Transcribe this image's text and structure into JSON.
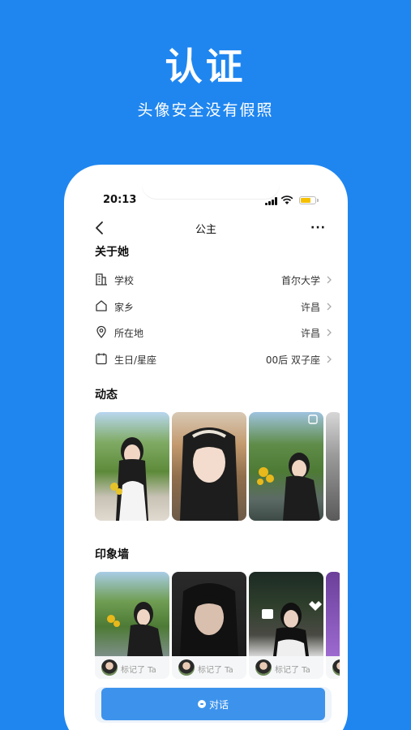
{
  "hero": {
    "title": "认证",
    "subtitle": "头像安全没有假照"
  },
  "status_bar": {
    "time": "20:13",
    "battery_level": 0.7
  },
  "nav": {
    "title": "公主"
  },
  "about": {
    "heading": "关于她",
    "rows": [
      {
        "icon": "building-icon",
        "label": "学校",
        "value": "首尔大学"
      },
      {
        "icon": "home-icon",
        "label": "家乡",
        "value": "许昌"
      },
      {
        "icon": "location-pin-icon",
        "label": "所在地",
        "value": "许昌"
      },
      {
        "icon": "calendar-icon",
        "label": "生日/星座",
        "value": "00后 双子座"
      }
    ]
  },
  "moments": {
    "heading": "动态"
  },
  "impressions": {
    "heading": "印象墙",
    "cards": [
      {
        "caption": "标记了 Ta"
      },
      {
        "caption": "标记了 Ta"
      },
      {
        "caption": "标记了 Ta"
      }
    ]
  },
  "action": {
    "label": "对话"
  },
  "colors": {
    "brand_blue": "#1f86f0",
    "button_blue": "#3d93ec",
    "battery_yellow": "#f5c000"
  }
}
